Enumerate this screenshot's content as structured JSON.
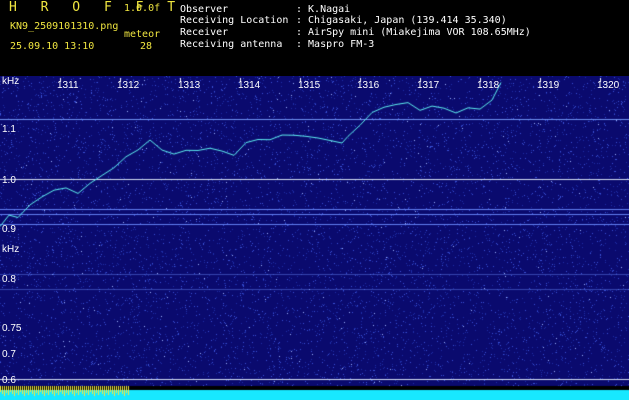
{
  "header": {
    "app_name": "H R O F F T",
    "version": "1.0.0f",
    "filename": "KN9_2509101310.png",
    "datetime": "25.09.10 13:10",
    "meteor_label": "meteor",
    "meteor_count": "28",
    "info_rows": [
      {
        "label": "Observer",
        "value": ": K.Nagai"
      },
      {
        "label": "Receiving Location",
        "value": ": Chigasaki, Japan (139.414 35.340)"
      },
      {
        "label": "Receiver",
        "value": ": AirSpy mini (Miakejima VOR 108.65MHz)"
      },
      {
        "label": "Receiving antenna",
        "value": ": Maspro FM-3"
      }
    ]
  },
  "spectrogram": {
    "y_unit_top": "kHz",
    "y_unit_left": "kHz",
    "y_ticks": [
      "1.1",
      "1.0",
      "0.9",
      "0.8",
      "0.75",
      "0.7",
      "0.6"
    ],
    "x_ticks": [
      "1311",
      "1312",
      "1313",
      "1314",
      "1315",
      "1316",
      "1317",
      "1318",
      "1319",
      "1320"
    ],
    "x_unit": "minute",
    "colors": {
      "background": "#0a0a6e",
      "noise": "#3a52d8",
      "trace": "#5ef0f0",
      "baseline": "#e8f4ff",
      "bottom_bar": "#18e8ff"
    },
    "trace_points": [
      [
        1310.0,
        0.905
      ],
      [
        1310.15,
        0.93
      ],
      [
        1310.3,
        0.92
      ],
      [
        1310.5,
        0.95
      ],
      [
        1310.7,
        0.965
      ],
      [
        1310.9,
        0.975
      ],
      [
        1311.1,
        0.985
      ],
      [
        1311.3,
        0.97
      ],
      [
        1311.5,
        0.99
      ],
      [
        1311.7,
        1.01
      ],
      [
        1311.9,
        1.02
      ],
      [
        1312.1,
        1.045
      ],
      [
        1312.3,
        1.06
      ],
      [
        1312.5,
        1.075
      ],
      [
        1312.7,
        1.06
      ],
      [
        1312.9,
        1.05
      ],
      [
        1313.1,
        1.055
      ],
      [
        1313.3,
        1.06
      ],
      [
        1313.5,
        1.06
      ],
      [
        1313.7,
        1.055
      ],
      [
        1313.9,
        1.05
      ],
      [
        1314.1,
        1.07
      ],
      [
        1314.3,
        1.08
      ],
      [
        1314.5,
        1.08
      ],
      [
        1314.7,
        1.085
      ],
      [
        1314.9,
        1.09
      ],
      [
        1315.1,
        1.085
      ],
      [
        1315.3,
        1.08
      ],
      [
        1315.5,
        1.08
      ],
      [
        1315.7,
        1.07
      ],
      [
        1315.8,
        1.085
      ],
      [
        1316.0,
        1.11
      ],
      [
        1316.2,
        1.13
      ],
      [
        1316.4,
        1.145
      ],
      [
        1316.6,
        1.15
      ],
      [
        1316.8,
        1.15
      ],
      [
        1317.0,
        1.14
      ],
      [
        1317.2,
        1.145
      ],
      [
        1317.4,
        1.14
      ],
      [
        1317.6,
        1.135
      ],
      [
        1317.8,
        1.14
      ],
      [
        1318.0,
        1.14
      ],
      [
        1318.2,
        1.16
      ],
      [
        1318.35,
        1.19
      ]
    ],
    "horizontal_lines_khz": [
      1.12,
      1.0,
      0.94,
      0.93,
      0.91,
      0.81,
      0.78,
      0.6
    ]
  }
}
